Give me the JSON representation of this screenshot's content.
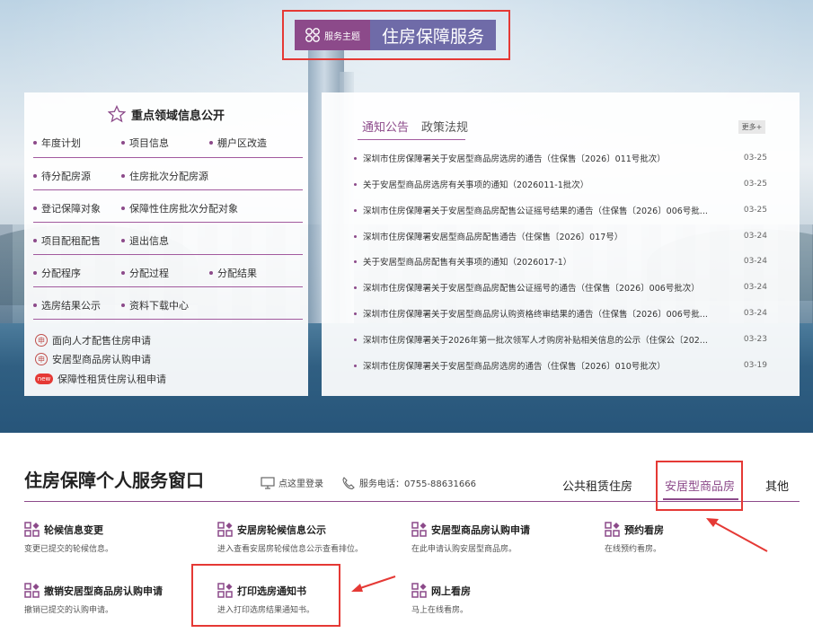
{
  "theme": {
    "tag_label": "服务主题",
    "title": "住房保障服务"
  },
  "left_panel": {
    "title": "重点领域信息公开",
    "rows": [
      [
        "年度计划",
        "项目信息",
        "棚户区改造"
      ],
      [
        "待分配房源",
        "住房批次分配房源"
      ],
      [
        "登记保障对象",
        "保障性住房批次分配对象"
      ],
      [
        "项目配租配售",
        "退出信息"
      ],
      [
        "分配程序",
        "分配过程",
        "分配结果"
      ],
      [
        "选房结果公示",
        "资料下载中心"
      ]
    ],
    "links": [
      {
        "label": "面向人才配售住房申请",
        "icon": "stamp-icon"
      },
      {
        "label": "安居型商品房认购申请",
        "icon": "stamp-icon"
      },
      {
        "label": "保障性租赁住房认租申请",
        "icon": "new-badge-icon",
        "badge": "new"
      }
    ]
  },
  "right_panel": {
    "tabs": [
      "通知公告",
      "政策法规"
    ],
    "more_label": "更多+",
    "news": [
      {
        "title": "深圳市住房保障署关于安居型商品房选房的通告（住保售〔2026〕011号批次）",
        "date": "03-25"
      },
      {
        "title": "关于安居型商品房选房有关事项的通知（2026011-1批次）",
        "date": "03-25"
      },
      {
        "title": "深圳市住房保障署关于安居型商品房配售公证摇号结果的通告（住保售〔2026〕006号批...",
        "date": "03-25"
      },
      {
        "title": "深圳市住房保障署安居型商品房配售通告（住保售〔2026〕017号）",
        "date": "03-24"
      },
      {
        "title": "关于安居型商品房配售有关事项的通知（2026017-1）",
        "date": "03-24"
      },
      {
        "title": "深圳市住房保障署关于安居型商品房配售公证摇号的通告（住保售〔2026〕006号批次）",
        "date": "03-24"
      },
      {
        "title": "深圳市住房保障署关于安居型商品房认购资格终审结果的通告（住保售〔2026〕006号批...",
        "date": "03-24"
      },
      {
        "title": "深圳市住房保障署关于2026年第一批次领军人才购房补贴相关信息的公示（住保公〔202...",
        "date": "03-23"
      },
      {
        "title": "深圳市住房保障署关于安居型商品房选房的通告（住保售〔2026〕010号批次）",
        "date": "03-19"
      }
    ]
  },
  "service_window": {
    "title": "住房保障个人服务窗口",
    "login_label": "点这里登录",
    "phone_label": "服务电话：0755-88631666",
    "tabs": [
      "公共租赁住房",
      "安居型商品房",
      "其他"
    ],
    "active_tab": "安居型商品房",
    "services": [
      {
        "title": "轮候信息变更",
        "desc": "变更已提交的轮候信息。"
      },
      {
        "title": "安居房轮候信息公示",
        "desc": "进入查看安居房轮候信息公示查看排位。"
      },
      {
        "title": "安居型商品房认购申请",
        "desc": "在此申请认购安居型商品房。"
      },
      {
        "title": "预约看房",
        "desc": "在线预约看房。"
      },
      {
        "title": "撤销安居型商品房认购申请",
        "desc": "撤销已提交的认购申请。"
      },
      {
        "title": "打印选房通知书",
        "desc": "进入打印选房结果通知书。"
      },
      {
        "title": "网上看房",
        "desc": "马上在线看房。"
      }
    ]
  },
  "colors": {
    "accent": "#8c4a8a",
    "theme_title_bg": "#6f6ba8",
    "highlight": "#e53935"
  }
}
